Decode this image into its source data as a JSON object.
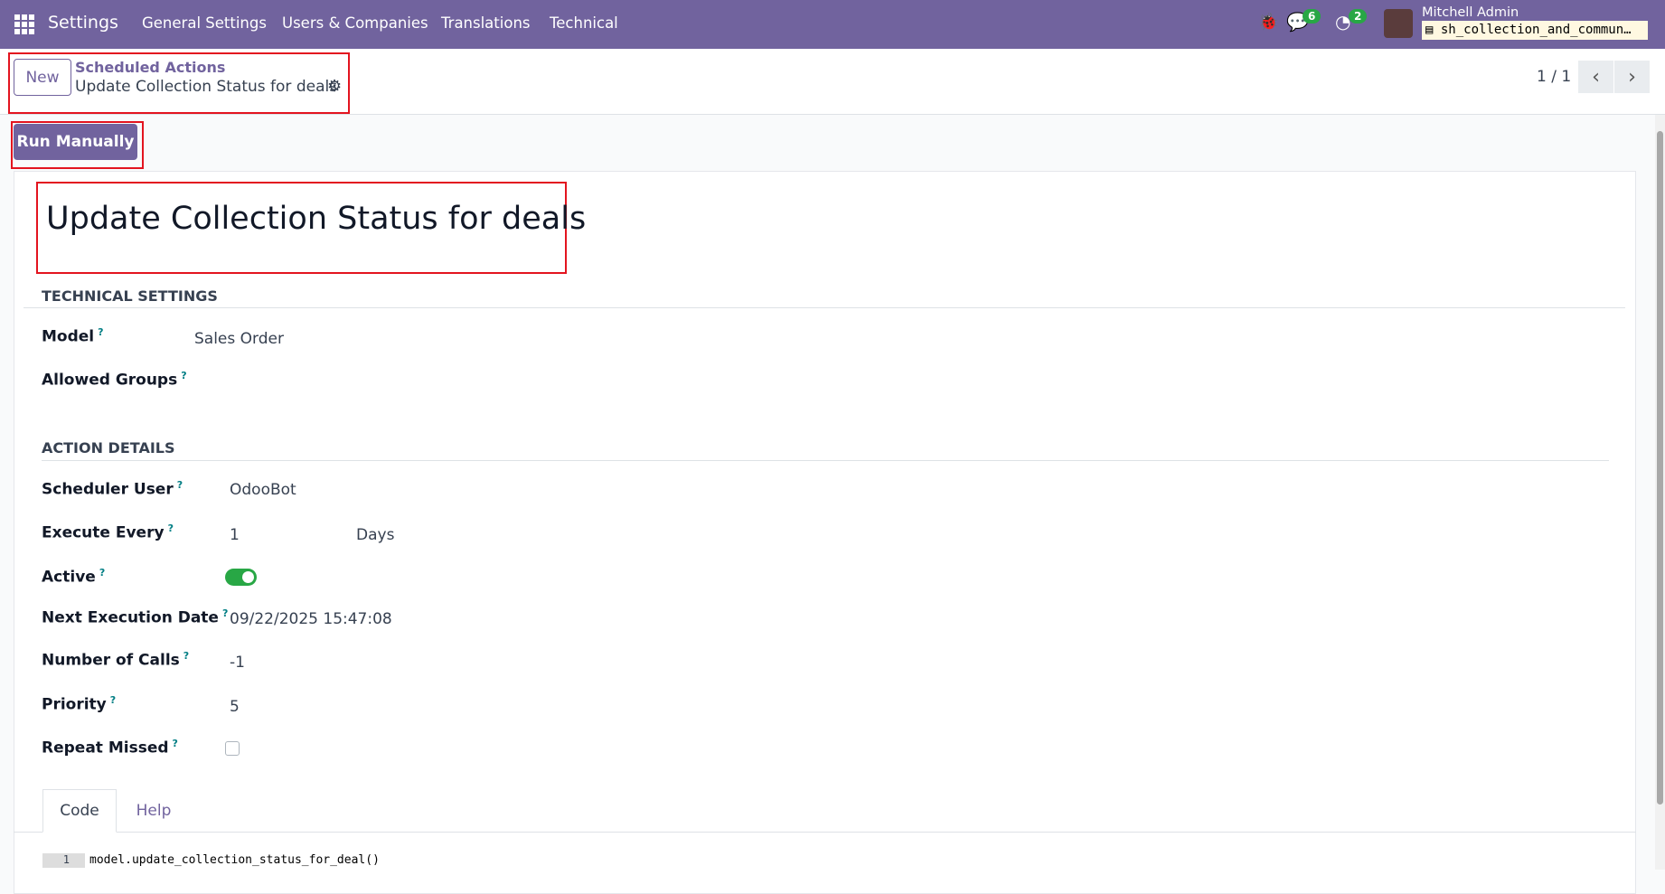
{
  "navbar": {
    "app": "Settings",
    "menus": [
      "General Settings",
      "Users & Companies",
      "Translations",
      "Technical"
    ],
    "messages_count": "6",
    "activities_count": "2",
    "user": "Mitchell Admin",
    "database": "sh_collection_and_commun…"
  },
  "control": {
    "new_label": "New",
    "breadcrumb_parent": "Scheduled Actions",
    "breadcrumb_current": "Update Collection Status for deals",
    "pager": "1 / 1",
    "run_label": "Run Manually"
  },
  "form": {
    "title": "Update Collection Status for deals",
    "tech_header": "TECHNICAL SETTINGS",
    "model_label": "Model",
    "model_value": "Sales Order",
    "groups_label": "Allowed Groups",
    "action_header": "ACTION DETAILS",
    "user_label": "Scheduler User",
    "user_value": "OdooBot",
    "every_label": "Execute Every",
    "every_value": "1",
    "every_unit": "Days",
    "active_label": "Active",
    "active": true,
    "next_label": "Next Execution Date",
    "next_value": "09/22/2025 15:47:08",
    "calls_label": "Number of Calls",
    "calls_value": "-1",
    "priority_label": "Priority",
    "priority_value": "5",
    "repeat_label": "Repeat Missed",
    "repeat": false,
    "help_mark": "?"
  },
  "tabs": [
    "Code",
    "Help"
  ],
  "code": {
    "line_no": "1",
    "line": "model.update_collection_status_for_deal()"
  }
}
